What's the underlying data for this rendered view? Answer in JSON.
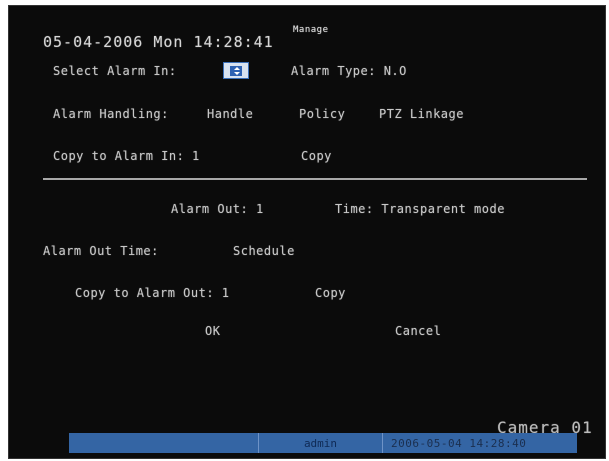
{
  "header": {
    "datetime": "05-04-2006 Mon 14:28:41",
    "menu_title": "Manage"
  },
  "alarm_in": {
    "select_label": "Select Alarm In:",
    "type_label": "Alarm Type: N.O",
    "handling_label": "Alarm Handling:",
    "handling_value": "Handle",
    "policy_label": "Policy",
    "ptz_label": "PTZ Linkage",
    "copy_to_label": "Copy to Alarm In: 1",
    "copy_button": "Copy"
  },
  "alarm_out": {
    "out_label": "Alarm Out: 1",
    "time_label": "Time: Transparent mode",
    "out_time_label": "Alarm Out Time:",
    "schedule_label": "Schedule",
    "copy_to_label": "Copy to Alarm Out: 1",
    "copy_button": "Copy"
  },
  "actions": {
    "ok": "OK",
    "cancel": "Cancel"
  },
  "overlay": {
    "camera": "Camera 01"
  },
  "status_bar": {
    "user": "admin",
    "time": "2006-05-04 14:28:40"
  },
  "colors": {
    "screen_bg": "#0b0b0b",
    "status_bar": "#3465a4",
    "focus_box": "#2e62b3"
  }
}
